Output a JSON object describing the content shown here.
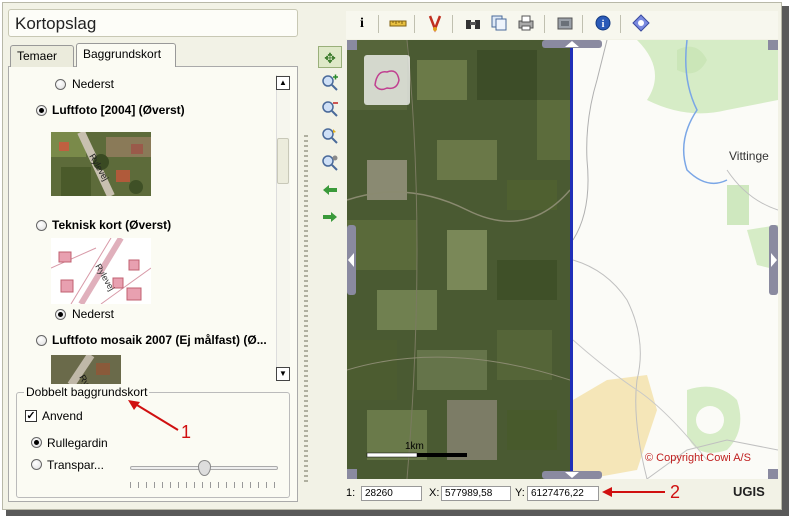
{
  "window": {
    "title": "Kortopslag"
  },
  "tabs": [
    {
      "label": "Temaer",
      "active": false
    },
    {
      "label": "Baggrundskort",
      "active": true
    }
  ],
  "layers": [
    {
      "label": "Nederst",
      "selected": false
    },
    {
      "label": "Luftfoto [2004] (Øverst)",
      "selected": true
    },
    {
      "label": "Teknisk kort (Øverst)",
      "selected": false
    },
    {
      "label": "Nederst",
      "selected": true
    },
    {
      "label": "Luftfoto mosaik 2007 (Ej målfast) (Ø...",
      "selected": false
    }
  ],
  "thumbnail_texts": {
    "street_a": "Rylevej",
    "street_b": "Rylevej",
    "street_c": "Ry"
  },
  "double_background": {
    "legend": "Dobbelt baggrundskort",
    "apply_label": "Anvend",
    "apply_checked": true,
    "mode_rullegardin": "Rullegardin",
    "mode_transparent": "Transpar...",
    "selected_mode": "Rullegardin"
  },
  "map": {
    "town_label": "Vittinge",
    "scale_label": "1km",
    "copyright": "© Copyright Cowi A/S",
    "divider_color": "#1f2fb8"
  },
  "status": {
    "scale_label": "1:",
    "scale_value": "28260",
    "x_label": "X:",
    "x_value": "577989,58",
    "y_label": "Y:",
    "y_value": "6127476,22",
    "logo": "UGIS"
  },
  "annotations": {
    "one": "1",
    "two": "2",
    "color": "#d01010"
  },
  "toolbar_icons": [
    "info-icon",
    "measure-icon",
    "draw-icon",
    "binoculars-icon",
    "copy-icon",
    "print-icon",
    "settings-icon",
    "help-icon",
    "globe-icon"
  ],
  "nav_icons": [
    "pan-icon",
    "zoom-in-icon",
    "zoom-out-icon",
    "zoom-extent-icon",
    "zoom-previous-icon",
    "back-arrow-icon",
    "forward-arrow-icon"
  ]
}
